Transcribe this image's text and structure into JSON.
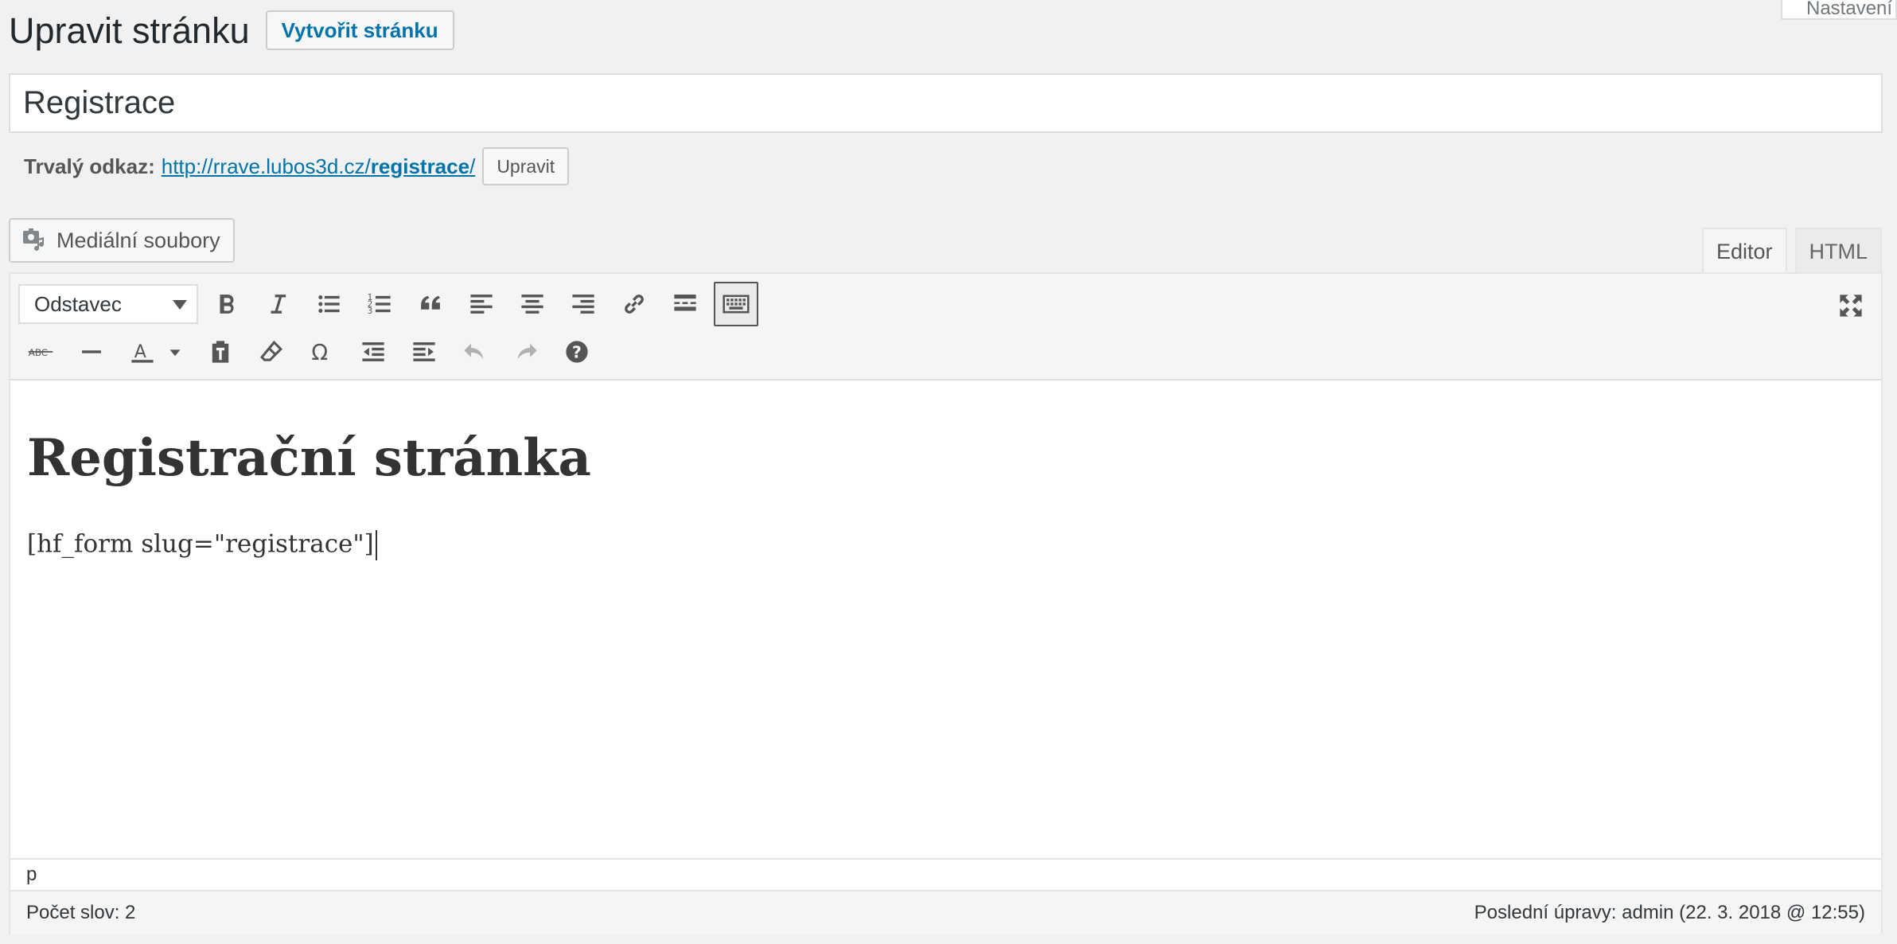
{
  "header": {
    "title": "Upravit stránku",
    "add_new_label": "Vytvořit stránku",
    "screen_options_label": "Nastavení"
  },
  "post_title": "Registrace",
  "permalink": {
    "label": "Trvalý odkaz:",
    "url_base": "http://rrave.lubos3d.cz/",
    "url_slug": "registrace",
    "url_tail": "/",
    "edit_label": "Upravit"
  },
  "media_button_label": "Mediální soubory",
  "tabs": {
    "visual": "Editor",
    "html": "HTML"
  },
  "toolbar": {
    "format_selected": "Odstavec",
    "row1_icons": [
      "bold-icon",
      "italic-icon",
      "bullet-list-icon",
      "numbered-list-icon",
      "blockquote-icon",
      "align-left-icon",
      "align-center-icon",
      "align-right-icon",
      "link-icon",
      "read-more-icon",
      "toolbar-toggle-icon"
    ],
    "row2_icons": [
      "strikethrough-icon",
      "horizontal-line-icon",
      "text-color-icon",
      "paste-as-text-icon",
      "clear-formatting-icon",
      "special-character-icon",
      "outdent-icon",
      "indent-icon",
      "undo-icon",
      "redo-icon",
      "help-icon"
    ]
  },
  "content": {
    "heading": "Registrační stránka",
    "paragraph": "[hf_form slug=\"registrace\"]"
  },
  "statusbar": {
    "path": "p"
  },
  "footer": {
    "word_count": "Počet slov: 2",
    "last_edited": "Poslední úpravy: admin (22. 3. 2018 @ 12:55)"
  }
}
